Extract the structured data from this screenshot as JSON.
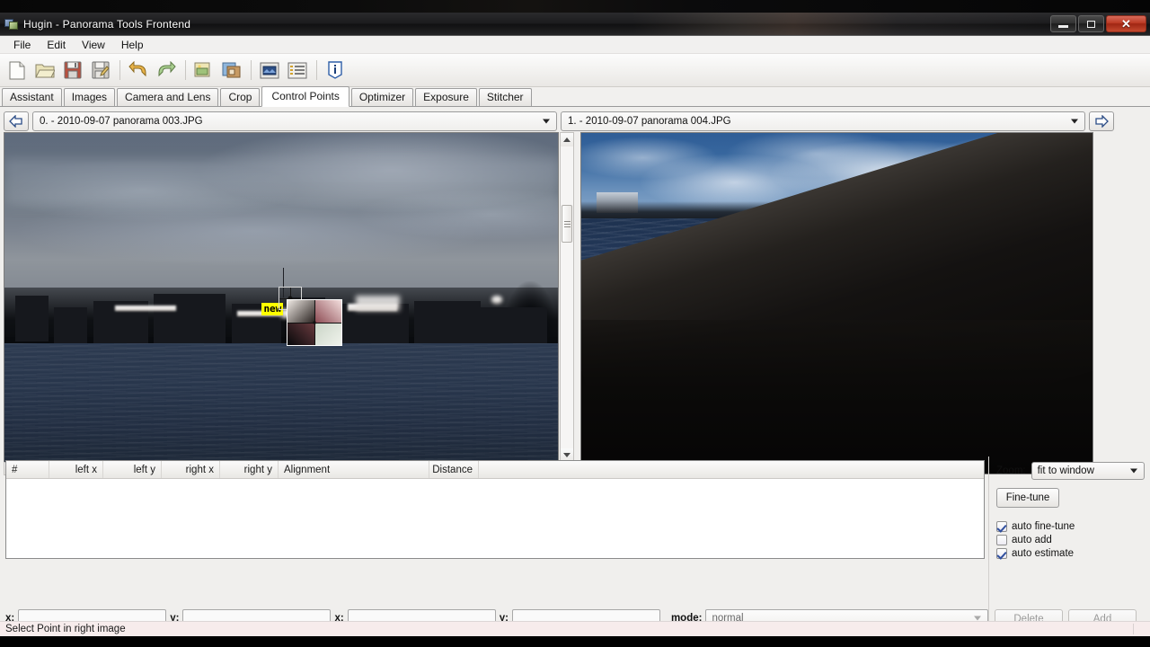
{
  "window": {
    "title": "Hugin - Panorama Tools Frontend",
    "app_icon": "hugin-app-icon",
    "buttons": {
      "minimize": "minimize-button",
      "maximize": "maximize-button",
      "close": "close-button"
    }
  },
  "menubar": {
    "items": [
      "File",
      "Edit",
      "View",
      "Help"
    ]
  },
  "toolbar": {
    "items": [
      {
        "name": "new-project-icon",
        "title": "New"
      },
      {
        "name": "open-project-icon",
        "title": "Open"
      },
      {
        "name": "save-project-icon",
        "title": "Save"
      },
      {
        "name": "save-as-project-icon",
        "title": "Save as"
      },
      {
        "name": "undo-icon",
        "title": "Undo"
      },
      {
        "name": "redo-icon",
        "title": "Redo"
      },
      {
        "name": "add-images-icon",
        "title": "Add images"
      },
      {
        "name": "add-images-dir-icon",
        "title": "Add images from directory"
      },
      {
        "name": "preview-panorama-icon",
        "title": "Show preview window"
      },
      {
        "name": "show-control-points-icon",
        "title": "Show control points"
      },
      {
        "name": "about-info-icon",
        "title": "About"
      }
    ]
  },
  "tabs": {
    "items": [
      "Assistant",
      "Images",
      "Camera and Lens",
      "Crop",
      "Control Points",
      "Optimizer",
      "Exposure",
      "Stitcher"
    ],
    "active": "Control Points"
  },
  "selectors": {
    "prev_arrow": "previous-image-button",
    "next_arrow": "next-image-button",
    "left_image": "0. - 2010-09-07 panorama 003.JPG",
    "right_image": "1. - 2010-09-07 panorama 004.JPG"
  },
  "left_pane": {
    "marker_label": "new",
    "vscroll": "left-image-vertical-scrollbar",
    "hscroll": "left-image-horizontal-scrollbar"
  },
  "right_pane": {
    "name": "right-image-canvas"
  },
  "cp_table": {
    "columns": [
      "#",
      "left x",
      "left y",
      "right x",
      "right y",
      "Alignment",
      "Distance"
    ],
    "rows": []
  },
  "fields": {
    "left_x_label": "x:",
    "left_y_label": "y:",
    "right_x_label": "x:",
    "right_y_label": "y:",
    "left_x_value": "",
    "left_y_value": "",
    "right_x_value": "",
    "right_y_value": "",
    "mode_label": "mode:",
    "mode_value": "normal"
  },
  "right_controls": {
    "zoom_label": "Zoom:",
    "zoom_value": "fit to window",
    "fine_tune_label": "Fine-tune",
    "checkboxes": [
      {
        "label": "auto fine-tune",
        "checked": true,
        "name": "auto-fine-tune-checkbox"
      },
      {
        "label": "auto add",
        "checked": false,
        "name": "auto-add-checkbox"
      },
      {
        "label": "auto estimate",
        "checked": true,
        "name": "auto-estimate-checkbox"
      }
    ],
    "delete_label": "Delete",
    "add_label": "Add"
  },
  "statusbar": {
    "message": "Select Point in right image"
  },
  "colors": {
    "accent_yellow": "#ffff00",
    "close_red": "#bc3a24",
    "status_bg": "#f7ecec",
    "panel_bg": "#f0efed"
  }
}
